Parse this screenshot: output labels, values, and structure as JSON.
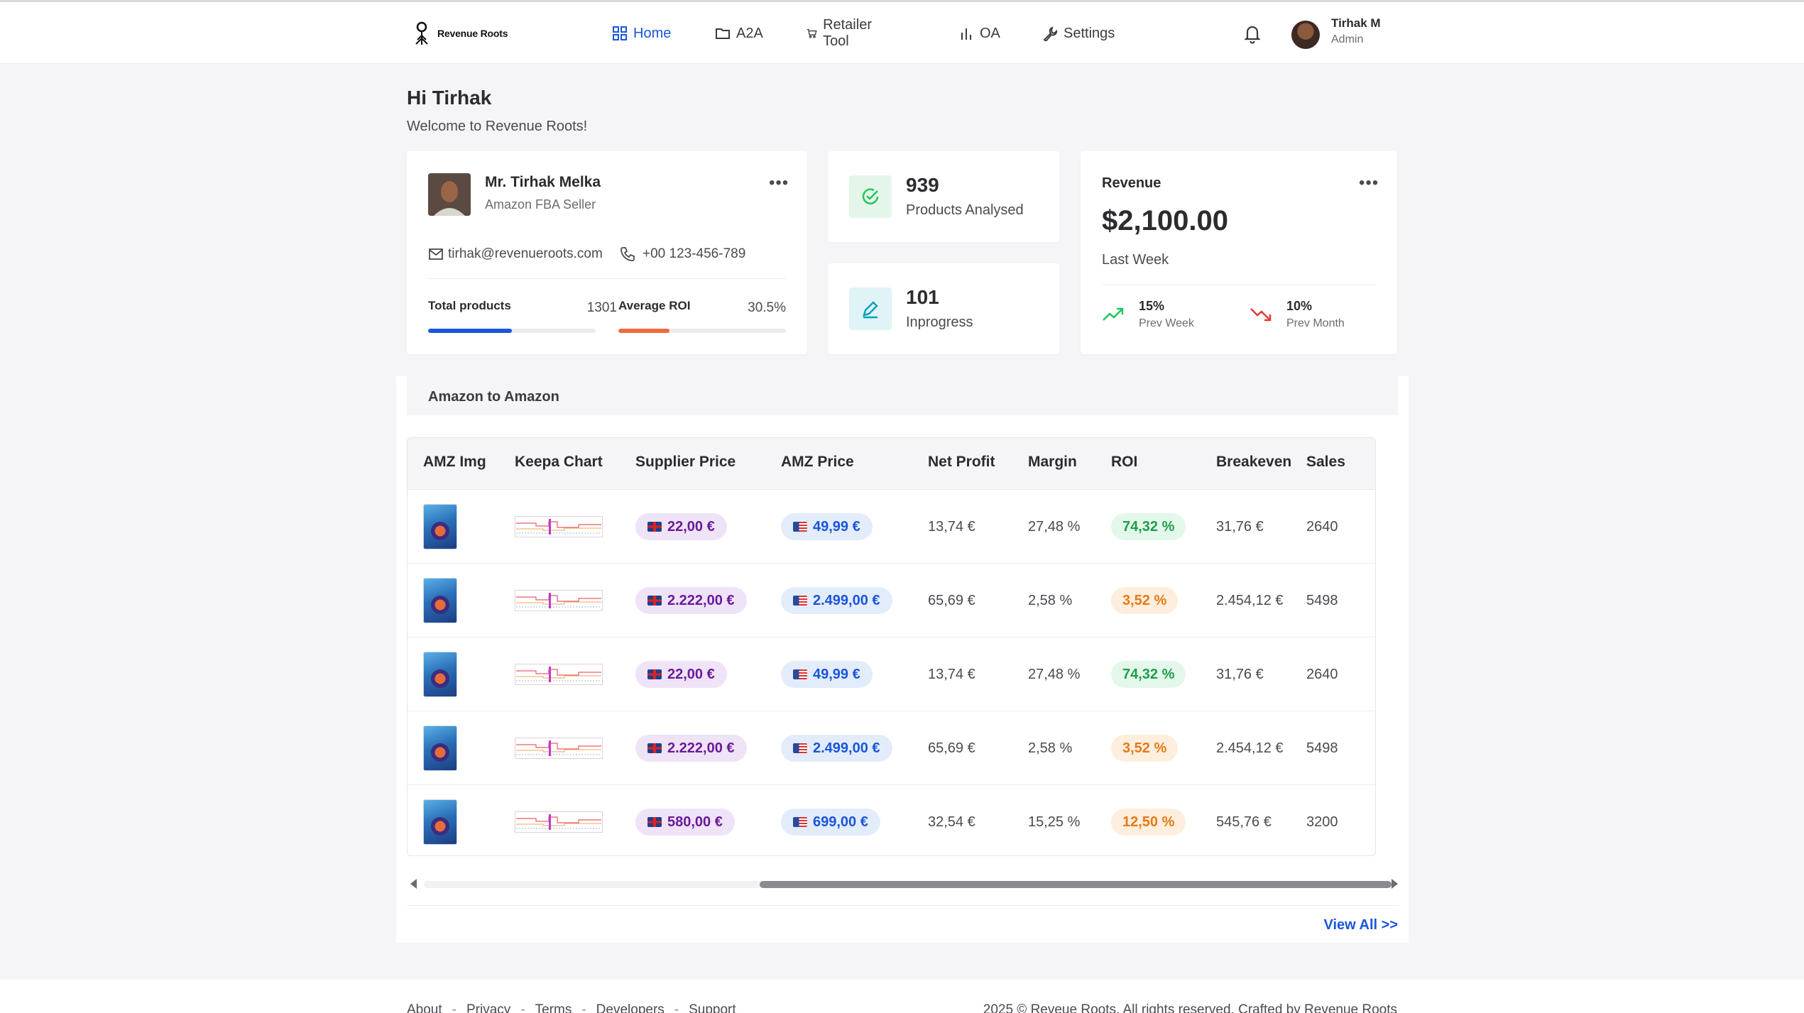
{
  "app": {
    "brand": "Revenue Roots"
  },
  "nav": [
    {
      "label": "Home",
      "icon": "grid-icon",
      "active": true
    },
    {
      "label": "A2A",
      "icon": "folder-icon",
      "active": false
    },
    {
      "label": "Retailer Tool",
      "icon": "cart-icon",
      "active": false
    },
    {
      "label": "OA",
      "icon": "bar-chart-icon",
      "active": false
    },
    {
      "label": "Settings",
      "icon": "wrench-icon",
      "active": false
    }
  ],
  "user": {
    "name": "Tirhak M",
    "role": "Admin"
  },
  "greeting": {
    "title": "Hi Tirhak",
    "subtitle": "Welcome to Revenue Roots!"
  },
  "profile": {
    "name": "Mr. Tirhak Melka",
    "role": "Amazon FBA Seller",
    "email": "tirhak@revenueroots.com",
    "phone": "+00 123-456-789",
    "total_products_label": "Total products",
    "total_products_value": "1301",
    "total_products_fill": 0.5,
    "avg_roi_label": "Average ROI",
    "avg_roi_value": "30.5%",
    "avg_roi_fill": 0.305,
    "colors": {
      "products_bar": "#1a56db",
      "roi_bar": "#f06a3a"
    }
  },
  "stats": [
    {
      "value": "939",
      "label": "Products Analysed",
      "icon": "check-circle-icon",
      "color": "#22c55e"
    },
    {
      "value": "101",
      "label": "Inprogress",
      "icon": "pencil-icon",
      "color": "#0e9fb8"
    }
  ],
  "revenue": {
    "title": "Revenue",
    "amount": "$2,100.00",
    "period": "Last Week",
    "prev_week_pct": "15%",
    "prev_week_label": "Prev Week",
    "prev_month_pct": "10%",
    "prev_month_label": "Prev Month",
    "colors": {
      "up": "#22c55e",
      "down": "#e53935"
    }
  },
  "table": {
    "title": "Amazon to Amazon",
    "columns": [
      "AMZ Img",
      "Keepa Chart",
      "Supplier Price",
      "AMZ Price",
      "Net Profit",
      "Margin",
      "ROI",
      "Breakeven",
      "Sales"
    ],
    "rows": [
      {
        "supplier": "22,00 €",
        "amz": "49,99 €",
        "profit": "13,74 €",
        "margin": "27,48 %",
        "roi": "74,32 %",
        "roi_level": "good",
        "breakeven": "31,76 €",
        "sales": "2640"
      },
      {
        "supplier": "2.222,00 €",
        "amz": "2.499,00 €",
        "profit": "65,69 €",
        "margin": "2,58 %",
        "roi": "3,52 %",
        "roi_level": "mid",
        "breakeven": "2.454,12 €",
        "sales": "5498"
      },
      {
        "supplier": "22,00 €",
        "amz": "49,99 €",
        "profit": "13,74 €",
        "margin": "27,48 %",
        "roi": "74,32 %",
        "roi_level": "good",
        "breakeven": "31,76 €",
        "sales": "2640"
      },
      {
        "supplier": "2.222,00 €",
        "amz": "2.499,00 €",
        "profit": "65,69 €",
        "margin": "2,58 %",
        "roi": "3,52 %",
        "roi_level": "mid",
        "breakeven": "2.454,12 €",
        "sales": "5498"
      },
      {
        "supplier": "580,00 €",
        "amz": "699,00 €",
        "profit": "32,54 €",
        "margin": "15,25 %",
        "roi": "12,50 %",
        "roi_level": "mid",
        "breakeven": "545,76 €",
        "sales": "3200"
      }
    ],
    "view_all": "View All >>"
  },
  "footer": {
    "links": [
      "About",
      "Privacy",
      "Terms",
      "Developers",
      "Support"
    ],
    "copyright": "2025 © Reveue Roots. All rights reserved. Crafted by Revenue Roots"
  }
}
